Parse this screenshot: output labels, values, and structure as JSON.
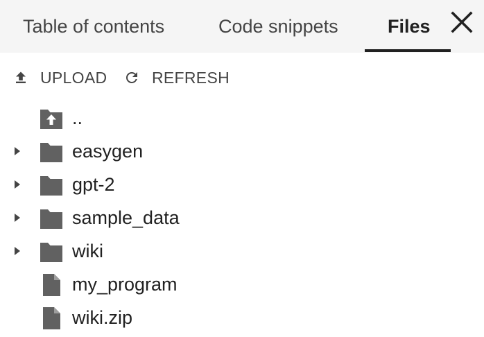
{
  "tabs": [
    {
      "label": "Table of contents"
    },
    {
      "label": "Code snippets"
    },
    {
      "label": "Files",
      "active": true
    }
  ],
  "toolbar": {
    "upload_label": "UPLOAD",
    "refresh_label": "REFRESH"
  },
  "files": [
    {
      "name": "..",
      "kind": "parent-folder",
      "icon": "folder-up-icon"
    },
    {
      "name": "easygen",
      "kind": "folder",
      "icon": "folder-icon",
      "expandable": true
    },
    {
      "name": "gpt-2",
      "kind": "folder",
      "icon": "folder-icon",
      "expandable": true
    },
    {
      "name": "sample_data",
      "kind": "folder",
      "icon": "folder-icon",
      "expandable": true
    },
    {
      "name": "wiki",
      "kind": "folder",
      "icon": "folder-icon",
      "expandable": true
    },
    {
      "name": "my_program",
      "kind": "file",
      "icon": "file-icon"
    },
    {
      "name": "wiki.zip",
      "kind": "file",
      "icon": "file-icon"
    }
  ],
  "colors": {
    "header_bg": "#f5f5f5",
    "icon_gray": "#616161",
    "text_dark": "#212121",
    "text_muted": "#444444"
  }
}
